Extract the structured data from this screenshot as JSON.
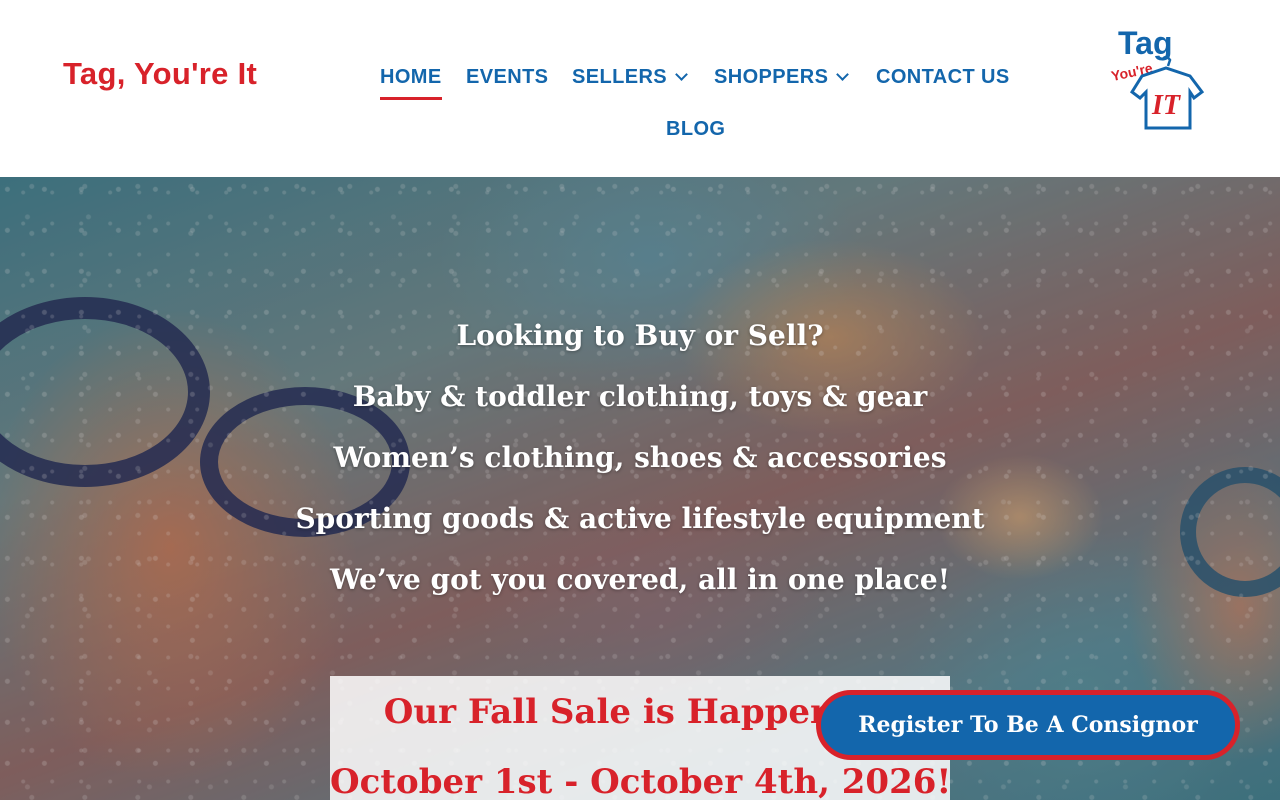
{
  "header": {
    "site_title": "Tag, You're It",
    "nav": {
      "home": "HOME",
      "events": "EVENTS",
      "sellers": "SELLERS",
      "shoppers": "SHOPPERS",
      "contact": "CONTACT US",
      "blog": "BLOG"
    },
    "logo": {
      "word1": "Tag",
      "word2": "You're",
      "word3": "IT"
    }
  },
  "hero": {
    "lines": [
      "Looking to Buy or Sell?",
      "Baby & toddler clothing, toys & gear",
      "Women’s clothing, shoes & accessories",
      "Sporting goods & active lifestyle equipment",
      "We’ve got you covered, all in one place!"
    ],
    "sale_headline": "Our Fall Sale is Happening",
    "sale_dates": "October 1st - October 4th, 2026!"
  },
  "cta": {
    "label": "Register To Be A Consignor"
  },
  "colors": {
    "brand_red": "#d8222a",
    "brand_blue": "#1366ac"
  }
}
